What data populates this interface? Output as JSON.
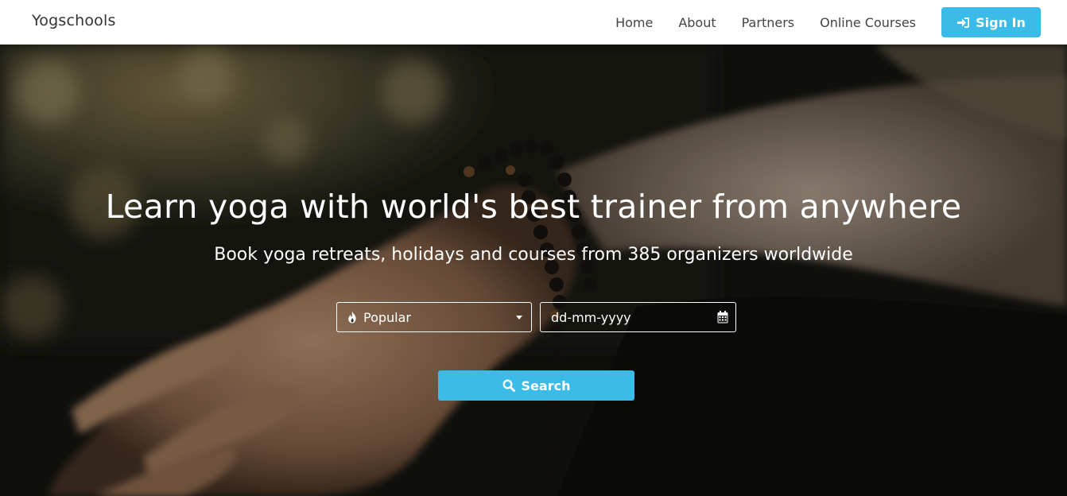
{
  "navbar": {
    "brand": "Yogschools",
    "links": [
      "Home",
      "About",
      "Partners",
      "Online Courses"
    ],
    "signin_label": "Sign In"
  },
  "hero": {
    "title": "Learn yoga with world's best trainer from anywhere",
    "subtitle": "Book yoga retreats, holidays and courses from 385 organizers worldwide",
    "category_select": {
      "selected": "Popular",
      "icon": "flame-icon"
    },
    "date_input": {
      "placeholder": "dd-mm-yyyy",
      "icon": "calendar-icon"
    },
    "search_label": "Search",
    "background": "yoga-hand-with-mala-beads"
  },
  "colors": {
    "accent": "#3bbbe8",
    "nav_bg": "#ffffff",
    "nav_text": "#444444",
    "hero_text": "#ffffff"
  }
}
